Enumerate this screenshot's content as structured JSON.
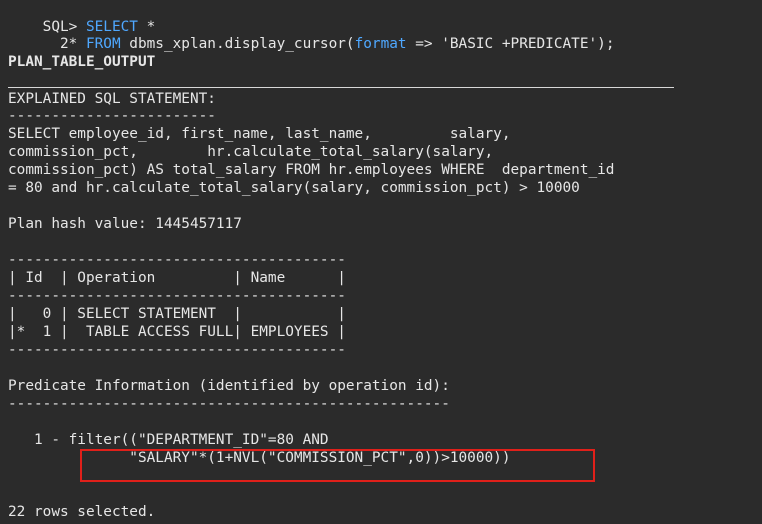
{
  "prompt": {
    "sql_prefix": "SQL> ",
    "select_kw": "SELECT",
    "select_rest": " *",
    "line2_num": "  2* ",
    "from_kw": "FROM",
    "from_mid": " dbms_xplan.display_cursor(",
    "format_kw": "format",
    "from_end": " => 'BASIC +PREDICATE');"
  },
  "output": {
    "column_header": "PLAN_TABLE_OUTPUT",
    "explained_heading": "EXPLAINED SQL STATEMENT:",
    "explained_dashes": "------------------------",
    "sql_lines": [
      "SELECT employee_id, first_name, last_name,         salary,",
      "commission_pct,        hr.calculate_total_salary(salary,",
      "commission_pct) AS total_salary FROM hr.employees WHERE  department_id",
      "= 80 and hr.calculate_total_salary(salary, commission_pct) > 10000"
    ],
    "plan_hash": "Plan hash value: 1445457117",
    "plan_table": {
      "border": "---------------------------------------",
      "header": "| Id  | Operation         | Name      |",
      "rows": [
        "|   0 | SELECT STATEMENT  |           |",
        "|*  1 |  TABLE ACCESS FULL| EMPLOYEES |"
      ]
    },
    "predicate_heading": "Predicate Information (identified by operation id):",
    "predicate_dashes": "---------------------------------------------------",
    "predicate_lines": [
      "   1 - filter((\"DEPARTMENT_ID\"=80 AND",
      "              \"SALARY\"*(1+NVL(\"COMMISSION_PCT\",0))>10000))"
    ],
    "rows_selected": "22 rows selected."
  },
  "colors": {
    "background": "#2b2b2b",
    "text": "#e6e6e6",
    "keyword": "#4fa8ff",
    "highlight_border": "#e0201a"
  }
}
